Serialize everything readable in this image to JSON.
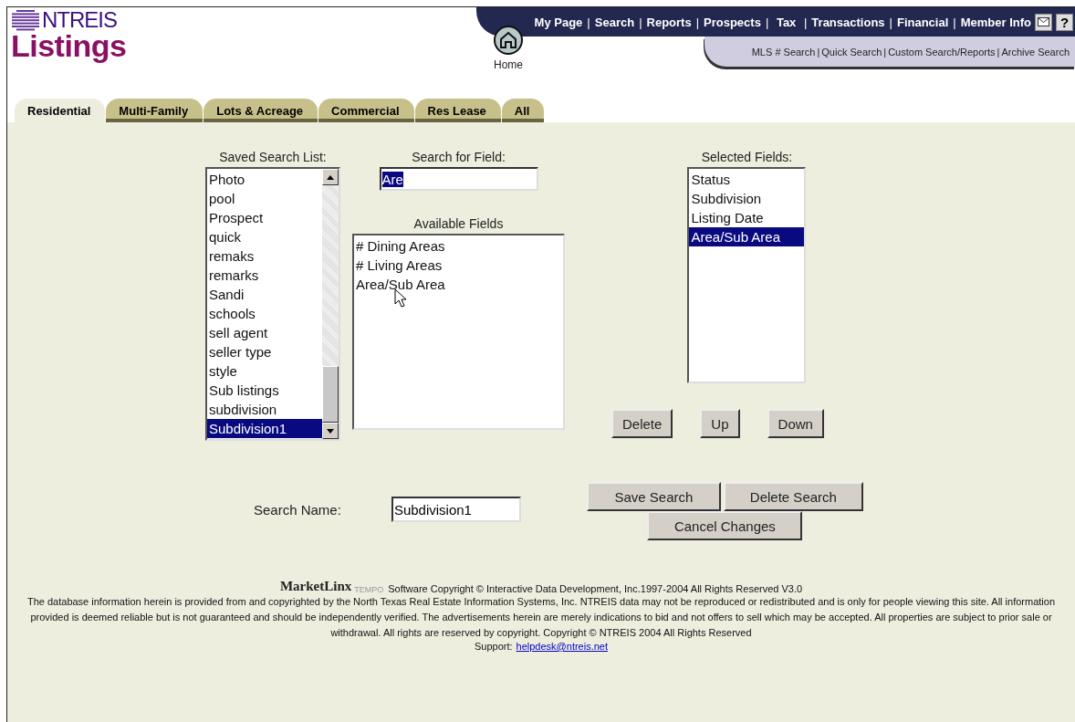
{
  "logo": {
    "top": "NTREIS",
    "bottom": "Listings"
  },
  "home": {
    "label": "Home"
  },
  "main_nav": [
    "My Page",
    "Search",
    "Reports",
    "Prospects",
    " Tax ",
    "Transactions",
    "Financial",
    "Member Info"
  ],
  "nav_separator": "|",
  "help": {
    "glyph": "?"
  },
  "sub_nav": [
    "MLS # Search",
    "Quick Search",
    "Custom Search/Reports",
    "Archive Search"
  ],
  "tabs": [
    {
      "label": "Residential",
      "selected": true
    },
    {
      "label": "Multi-Family",
      "selected": false
    },
    {
      "label": "Lots & Acreage",
      "selected": false
    },
    {
      "label": "Commercial",
      "selected": false
    },
    {
      "label": "Res Lease",
      "selected": false
    },
    {
      "label": "All",
      "selected": false
    }
  ],
  "saved_search_list": {
    "label": "Saved Search List:",
    "items": [
      {
        "label": "Photo",
        "selected": false
      },
      {
        "label": "pool",
        "selected": false
      },
      {
        "label": "Prospect",
        "selected": false
      },
      {
        "label": "quick",
        "selected": false
      },
      {
        "label": "remaks",
        "selected": false
      },
      {
        "label": "remarks",
        "selected": false
      },
      {
        "label": "Sandi",
        "selected": false
      },
      {
        "label": "schools",
        "selected": false
      },
      {
        "label": "sell agent",
        "selected": false
      },
      {
        "label": "seller type",
        "selected": false
      },
      {
        "label": "style",
        "selected": false
      },
      {
        "label": "Sub listings",
        "selected": false
      },
      {
        "label": "subdivision",
        "selected": false
      },
      {
        "label": "Subdivision1",
        "selected": true
      }
    ]
  },
  "search_for_field": {
    "label": "Search for Field:",
    "value": "Are",
    "value_selected": true
  },
  "available_fields": {
    "label": "Available Fields",
    "items": [
      {
        "label": "# Dining Areas",
        "selected": false
      },
      {
        "label": "# Living Areas",
        "selected": false
      },
      {
        "label": "Area/Sub Area",
        "selected": false
      }
    ]
  },
  "selected_fields": {
    "label": "Selected Fields:",
    "items": [
      {
        "label": "Status",
        "selected": false
      },
      {
        "label": "Subdivision",
        "selected": false
      },
      {
        "label": "Listing Date",
        "selected": false
      },
      {
        "label": "Area/Sub Area",
        "selected": true
      }
    ]
  },
  "field_buttons": [
    "Delete",
    "Up",
    "Down"
  ],
  "search_name": {
    "label": "Search Name:",
    "value": "Subdivision1"
  },
  "search_buttons": [
    "Save Search",
    "Delete Search",
    "Cancel Changes"
  ],
  "footer": {
    "brand": "MarketLinx",
    "brand_sub": "TEMPO",
    "copyright": "Software Copyright © Interactive Data Development, Inc.1997-2004 All Rights Reserved V3.0",
    "disclaimer": "The database information herein is provided from and copyrighted by the North Texas Real Estate Information Systems, Inc. NTREIS data may not be reproduced or redistributed and is only for people viewing this site. All information provided is deemed reliable but is not guaranteed and should be independently verified. The advertisements herein are merely indications to bid and not offers to sell which may be accepted. All properties are subject to prior sale or withdrawal. All rights are reserved by copyright. Copyright © NTREIS 2004 All Rights Reserved",
    "support_label": "Support:",
    "support_link": "helpdesk@ntreis.net"
  }
}
